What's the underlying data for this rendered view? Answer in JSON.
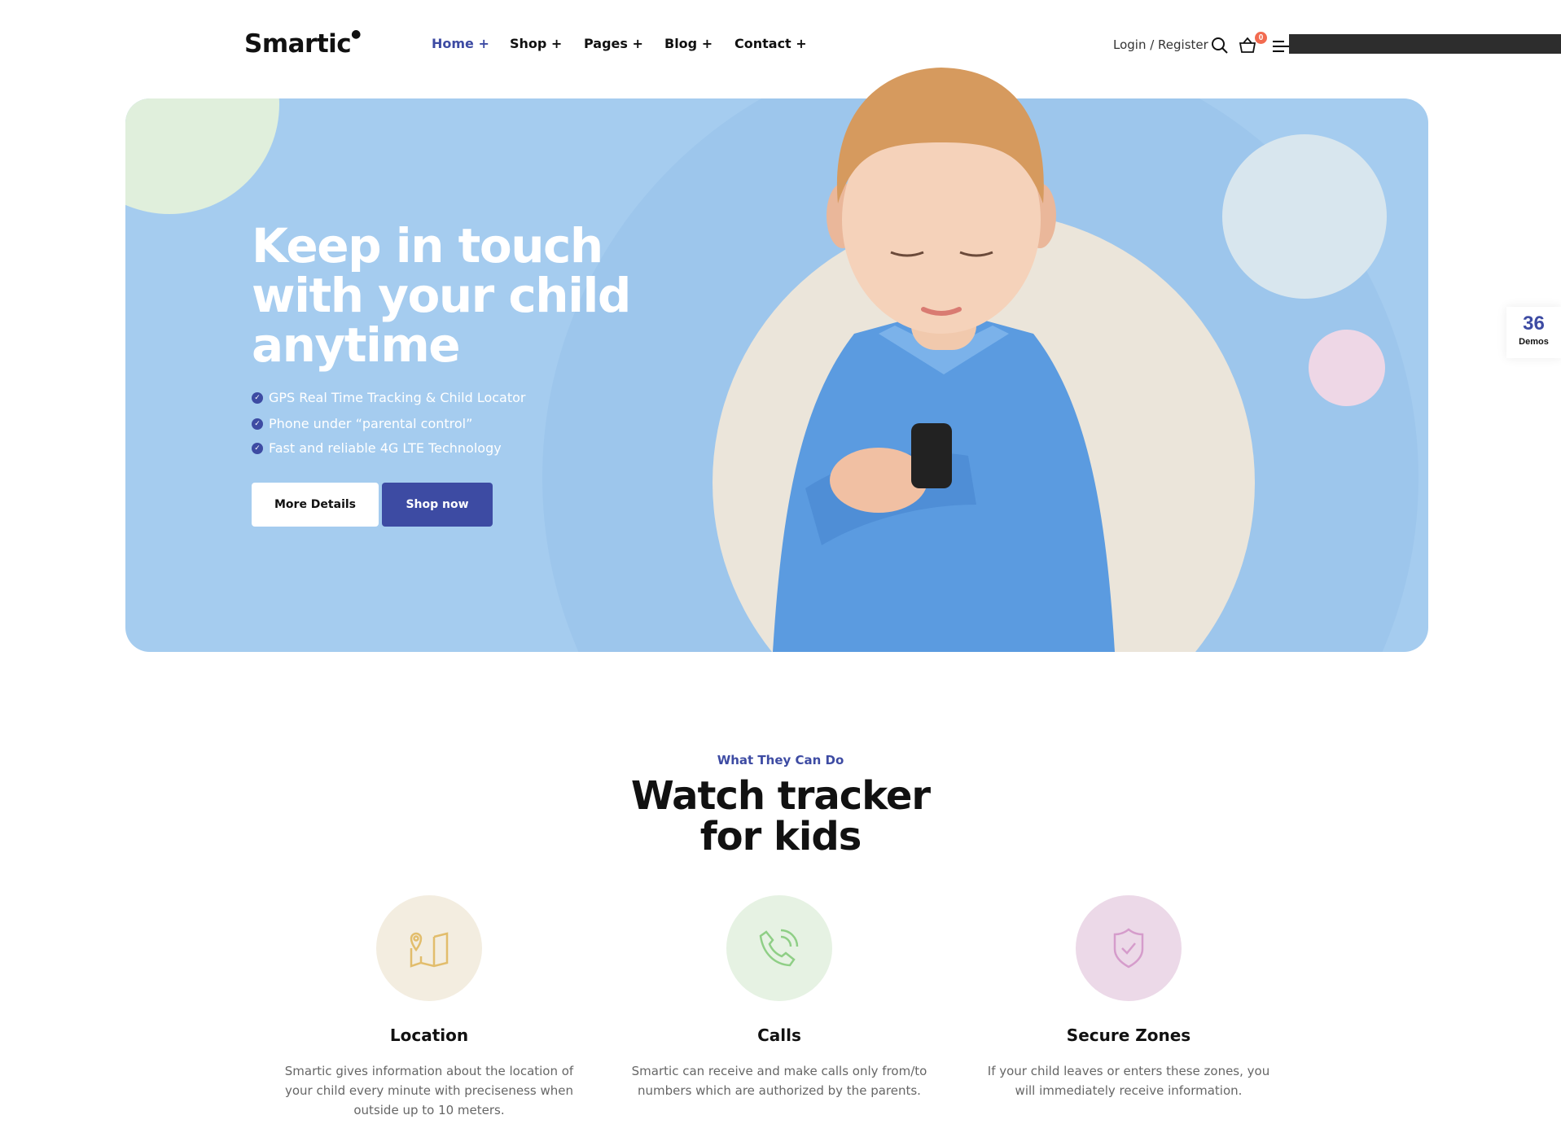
{
  "header": {
    "logo": "Smartic",
    "nav": [
      {
        "label": "Home +",
        "active": true
      },
      {
        "label": "Shop +"
      },
      {
        "label": "Pages +"
      },
      {
        "label": "Blog +"
      },
      {
        "label": "Contact +"
      }
    ],
    "login": "Login / Register",
    "cart_count": "0"
  },
  "hero": {
    "title_lines": [
      "Keep in touch",
      "with your child",
      "anytime"
    ],
    "bullets": [
      "GPS Real Time Tracking & Child Locator",
      "Phone under “parental control”",
      "Fast and reliable 4G LTE Technology"
    ],
    "more_label": "More Details",
    "shop_label": "Shop now"
  },
  "demos": {
    "count": "36",
    "label": "Demos"
  },
  "section": {
    "kicker": "What They Can Do",
    "title_lines": [
      "Watch tracker",
      "for kids"
    ],
    "features": [
      {
        "icon": "map-pin-icon",
        "title": "Location",
        "desc": "Smartic gives information about the location of your child every minute with preciseness when outside up to 10 meters.",
        "color": "#f3ede0"
      },
      {
        "icon": "phone-call-icon",
        "title": "Calls",
        "desc": "Smartic can receive and make calls only from/to numbers which are authorized by the parents.",
        "color": "#e6f2e3"
      },
      {
        "icon": "shield-check-icon",
        "title": "Secure Zones",
        "desc": "If your child leaves or enters these zones, you will immediately receive information.",
        "color": "#ecd9e8"
      }
    ]
  },
  "colors": {
    "accent": "#3d4ba3",
    "hero_bg": "#a5ccef",
    "badge": "#f26b50"
  }
}
